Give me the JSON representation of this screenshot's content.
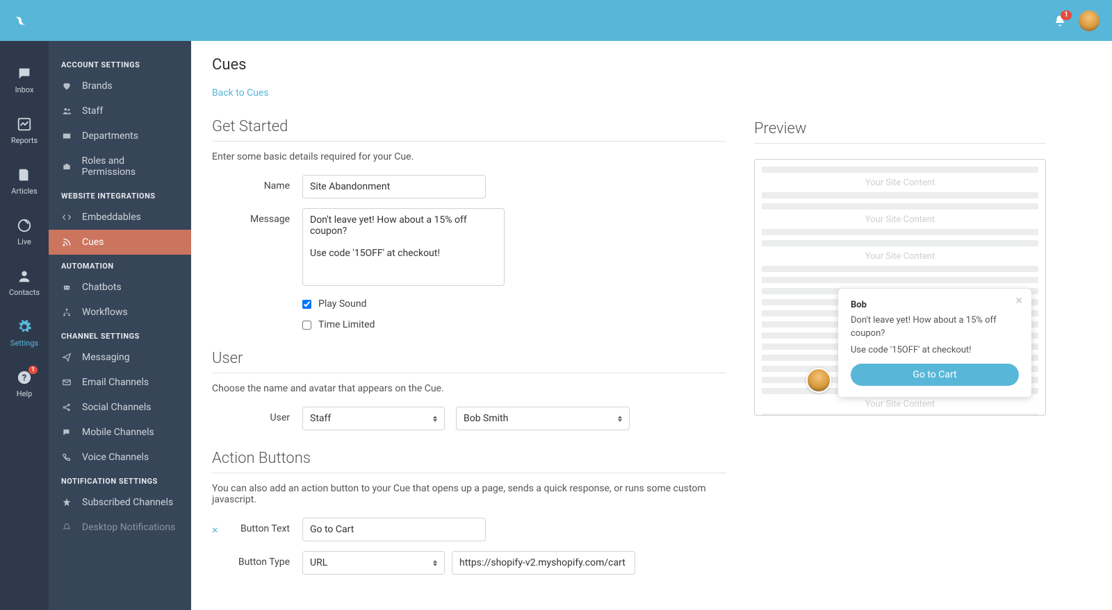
{
  "topbar": {
    "notification_count": "1"
  },
  "primary_nav": [
    {
      "key": "inbox",
      "label": "Inbox"
    },
    {
      "key": "reports",
      "label": "Reports"
    },
    {
      "key": "articles",
      "label": "Articles"
    },
    {
      "key": "live",
      "label": "Live"
    },
    {
      "key": "contacts",
      "label": "Contacts"
    },
    {
      "key": "settings",
      "label": "Settings"
    },
    {
      "key": "help",
      "label": "Help",
      "badge": "1"
    }
  ],
  "sidebar": {
    "groups": [
      {
        "heading": "ACCOUNT SETTINGS",
        "items": [
          {
            "label": "Brands"
          },
          {
            "label": "Staff"
          },
          {
            "label": "Departments"
          },
          {
            "label": "Roles and Permissions"
          }
        ]
      },
      {
        "heading": "WEBSITE INTEGRATIONS",
        "items": [
          {
            "label": "Embeddables"
          },
          {
            "label": "Cues",
            "active": true
          }
        ]
      },
      {
        "heading": "AUTOMATION",
        "items": [
          {
            "label": "Chatbots"
          },
          {
            "label": "Workflows"
          }
        ]
      },
      {
        "heading": "CHANNEL SETTINGS",
        "items": [
          {
            "label": "Messaging"
          },
          {
            "label": "Email Channels"
          },
          {
            "label": "Social Channels"
          },
          {
            "label": "Mobile Channels"
          },
          {
            "label": "Voice Channels"
          }
        ]
      },
      {
        "heading": "NOTIFICATION SETTINGS",
        "items": [
          {
            "label": "Subscribed Channels"
          },
          {
            "label": "Desktop Notifications"
          }
        ]
      }
    ]
  },
  "page": {
    "title": "Cues",
    "back_link": "Back to Cues"
  },
  "get_started": {
    "heading": "Get Started",
    "desc": "Enter some basic details required for your Cue.",
    "name_label": "Name",
    "name_value": "Site Abandonment",
    "message_label": "Message",
    "message_value": "Don't leave yet! How about a 15% off coupon?\n\nUse code '15OFF' at checkout!",
    "play_sound_label": "Play Sound",
    "play_sound_checked": true,
    "time_limited_label": "Time Limited",
    "time_limited_checked": false
  },
  "user_section": {
    "heading": "User",
    "desc": "Choose the name and avatar that appears on the Cue.",
    "user_label": "User",
    "type_value": "Staff",
    "staff_value": "Bob Smith"
  },
  "action_buttons": {
    "heading": "Action Buttons",
    "desc": "You can also add an action button to your Cue that opens up a page, sends a quick response, or runs some custom javascript.",
    "button_text_label": "Button Text",
    "button_text_value": "Go to Cart",
    "button_type_label": "Button Type",
    "button_type_value": "URL",
    "button_url_value": "https://shopify-v2.myshopify.com/cart"
  },
  "preview": {
    "heading": "Preview",
    "placeholder": "Your Site Content",
    "cue_name": "Bob",
    "cue_msg1": "Don't leave yet! How about a 15% off coupon?",
    "cue_msg2": "Use code '15OFF' at checkout!",
    "cue_btn": "Go to Cart"
  }
}
